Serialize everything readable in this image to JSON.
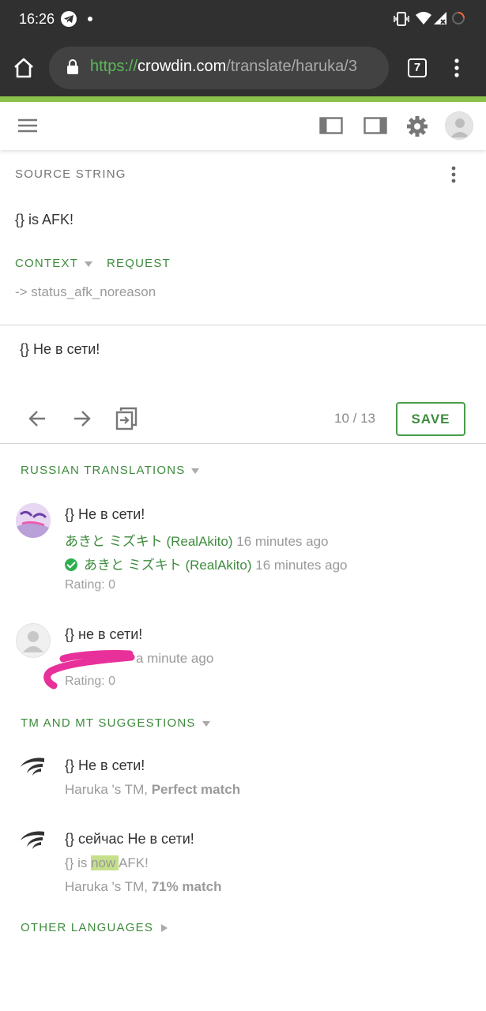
{
  "status_bar": {
    "time": "16:26",
    "icons": [
      "telegram-icon",
      "dot-icon",
      "vibrate-icon",
      "wifi-icon",
      "no-signal-icon",
      "loading-icon"
    ]
  },
  "browser": {
    "url_scheme": "https://",
    "url_host": "crowdin.com",
    "url_path": "/translate/haruka/3",
    "tab_count": "7"
  },
  "colors": {
    "accent_green": "#3d8b3d",
    "bar_green": "#8bc34a",
    "dark_bar": "#303030"
  },
  "source": {
    "label": "SOURCE STRING",
    "text": "{} is AFK!",
    "context_label": "CONTEXT",
    "request_label": "REQUEST",
    "context_value": "-> status_afk_noreason"
  },
  "editor": {
    "translation_text": "{} Не в сети!",
    "counter": "10 / 13",
    "save_label": "SAVE"
  },
  "russian_translations": {
    "label": "RUSSIAN TRANSLATIONS",
    "items": [
      {
        "text": "{} Не в сети!",
        "author": "あきと ミズキト (RealAkito)",
        "time": "16 minutes ago",
        "approver": "あきと ミズキト (RealAkito)",
        "approve_time": "16 minutes ago",
        "rating": "Rating: 0"
      },
      {
        "text": "{} не в сети!",
        "time": "a minute ago",
        "rating": "Rating: 0"
      }
    ]
  },
  "suggestions": {
    "label": "TM AND MT SUGGESTIONS",
    "items": [
      {
        "text": "{} Не в сети!",
        "source_prefix": "Haruka 's TM, ",
        "match": "Perfect match"
      },
      {
        "text": "{} сейчас Не в сети!",
        "diff_before": "{} is ",
        "diff_highlight": "now ",
        "diff_after": "AFK!",
        "source_prefix": "Haruka 's TM, ",
        "match": "71% match"
      }
    ]
  },
  "other_languages": {
    "label": "OTHER LANGUAGES"
  }
}
